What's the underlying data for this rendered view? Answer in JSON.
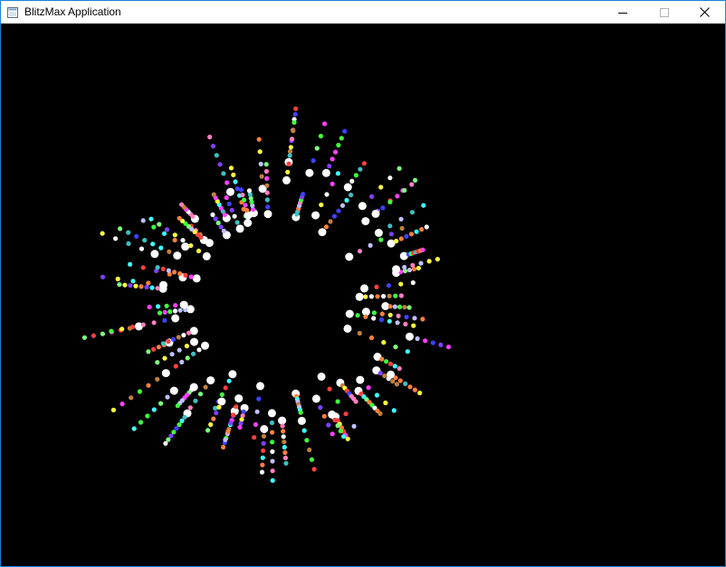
{
  "window": {
    "title": "BlitzMax Application",
    "icon": "app-window-icon",
    "border_color": "#1883d7"
  },
  "caption_buttons": {
    "minimize": "minimize-icon",
    "maximize": "maximize-icon",
    "close": "close-icon"
  },
  "canvas": {
    "background": "#000000",
    "content": "particle-burst",
    "head_color": "#ffffff",
    "trail_palette": [
      "#ff4040",
      "#40ff40",
      "#4040ff",
      "#ffff40",
      "#ff40ff",
      "#40ffff",
      "#ff8040",
      "#c0c0ff",
      "#80ff80",
      "#ff80c0",
      "#8040ff",
      "#40c0c0",
      "#c08040",
      "#ffffff"
    ]
  }
}
